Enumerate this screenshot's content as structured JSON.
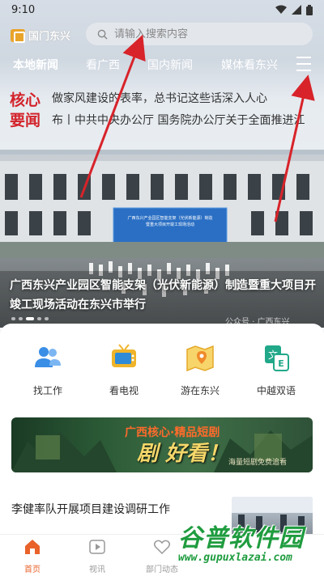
{
  "status_bar": {
    "time": "9:10"
  },
  "header": {
    "logo_text": "国门东兴",
    "search_placeholder": "请输入搜索内容"
  },
  "tabs": [
    {
      "label": "本地新闻",
      "active": true
    },
    {
      "label": "看广西",
      "active": false
    },
    {
      "label": "国内新闻",
      "active": false
    },
    {
      "label": "媒体看东兴",
      "active": false
    }
  ],
  "headlines": {
    "label_line1": "核心",
    "label_line2": "要闻",
    "line1": "做家风建设的表率，总书记这些话深入人心",
    "line2": "布丨中共中央办公厅 国务院办公厅关于全面推进江"
  },
  "banner": {
    "caption": "广西东兴产业园区智能支架（光伏新能源）制造暨重大项目开竣工现场活动在东兴市举行",
    "watermark": "公众号 · 广西东兴",
    "stage_text": "广西东兴产业园区智能支架（光伏新能源）制造暨重大项目开竣工现场活动",
    "dots": 5,
    "active_dot": 2
  },
  "services": [
    {
      "label": "找工作",
      "icon": "people-icon"
    },
    {
      "label": "看电视",
      "icon": "tv-icon"
    },
    {
      "label": "游在东兴",
      "icon": "map-icon"
    },
    {
      "label": "中越双语",
      "icon": "translate-icon"
    }
  ],
  "promo": {
    "title": "广西核心·精品短剧",
    "big_text": "剧 好看！",
    "sub_text": "海量短剧免费追看"
  },
  "news": [
    {
      "title": "李健率队开展项目建设调研工作"
    }
  ],
  "bottom_nav": [
    {
      "label": "首页",
      "active": true
    },
    {
      "label": "视讯",
      "active": false
    },
    {
      "label": "部门动态",
      "active": false
    }
  ],
  "site_watermark": {
    "name": "谷普软件园",
    "url": "www.gupuxlazai.com"
  },
  "colors": {
    "headline_red": "#d3222a",
    "active_orange": "#e9622a",
    "service_blue": "#3a8ee6",
    "service_yellow": "#f0b42a",
    "watermark_green": "#1f9c3f"
  }
}
